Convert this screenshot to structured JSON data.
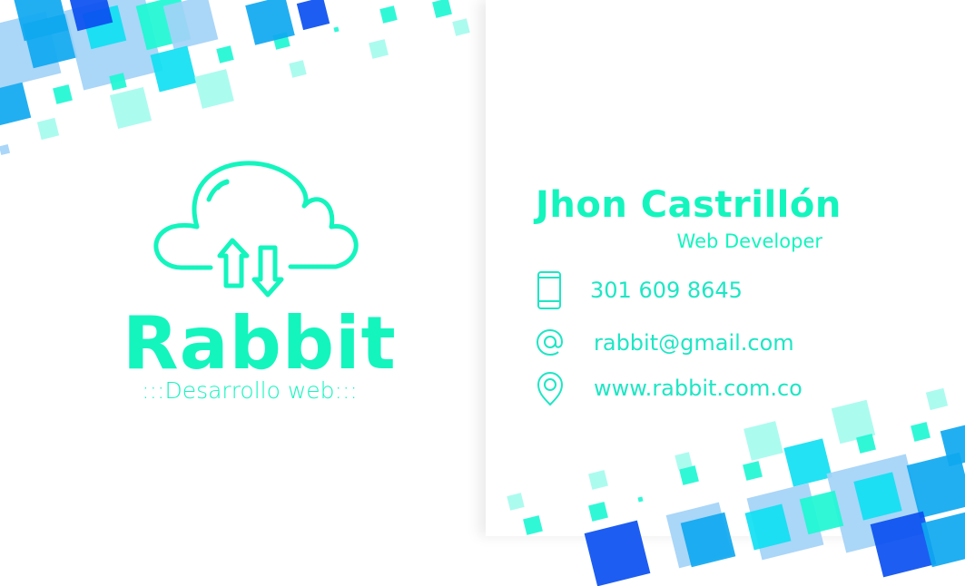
{
  "colors": {
    "accent": "#14f5be",
    "contact": "#1ee6c4",
    "blue_dark": "#0a4ff0",
    "blue": "#0fa8f0",
    "cyan": "#10dff2",
    "light": "#a3d3f7",
    "mint": "#a5fbee",
    "teal": "#1ef7d4"
  },
  "logo": {
    "brand": "Rabbit",
    "tagline": ":::Desarrollo web:::",
    "icon": "cloud-upload-download-icon"
  },
  "person": {
    "name": "Jhon Castrillón",
    "role": "Web Developer"
  },
  "contacts": [
    {
      "icon": "phone-icon",
      "value": "301 609 8645"
    },
    {
      "icon": "at-sign-icon",
      "value": "rabbit@gmail.com"
    },
    {
      "icon": "location-pin-icon",
      "value": "www.rabbit.com.co"
    }
  ]
}
